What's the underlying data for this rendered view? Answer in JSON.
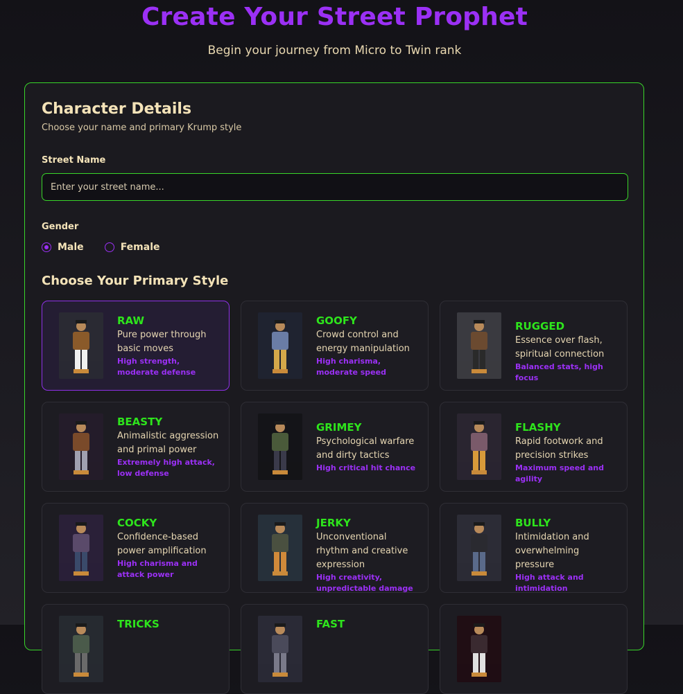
{
  "header": {
    "title": "Create Your Street Prophet",
    "subtitle": "Begin your journey from Micro to Twin rank"
  },
  "details": {
    "title": "Character Details",
    "subtitle": "Choose your name and primary Krump style",
    "street_name_label": "Street Name",
    "street_name_placeholder": "Enter your street name...",
    "street_name_value": "",
    "gender_label": "Gender",
    "gender_options": [
      "Male",
      "Female"
    ],
    "gender_selected": "Male"
  },
  "styles": {
    "title": "Choose Your Primary Style",
    "selected": "RAW",
    "items": [
      {
        "name": "RAW",
        "desc": "Pure power through basic moves",
        "stat": "High strength, moderate defense"
      },
      {
        "name": "GOOFY",
        "desc": "Crowd control and energy manipulation",
        "stat": "High charisma, moderate speed"
      },
      {
        "name": "RUGGED",
        "desc": "Essence over flash, spiritual connection",
        "stat": "Balanced stats, high focus"
      },
      {
        "name": "BEASTY",
        "desc": "Animalistic aggression and primal power",
        "stat": "Extremely high attack, low defense"
      },
      {
        "name": "GRIMEY",
        "desc": "Psychological warfare and dirty tactics",
        "stat": "High critical hit chance"
      },
      {
        "name": "FLASHY",
        "desc": "Rapid footwork and precision strikes",
        "stat": "Maximum speed and agility"
      },
      {
        "name": "COCKY",
        "desc": "Confidence-based power amplification",
        "stat": "High charisma and attack power"
      },
      {
        "name": "JERKY",
        "desc": "Unconventional rhythm and creative expression",
        "stat": "High creativity, unpredictable damage"
      },
      {
        "name": "BULLY",
        "desc": "Intimidation and overwhelming pressure",
        "stat": "High attack and intimidation"
      },
      {
        "name": "TRICKS",
        "desc": "",
        "stat": ""
      },
      {
        "name": "FAST",
        "desc": "",
        "stat": ""
      },
      {
        "name": "",
        "desc": "",
        "stat": ""
      }
    ]
  },
  "colors": {
    "accent": "#9b30f5",
    "border_green": "#39d62a",
    "style_name": "#2ee51c"
  }
}
